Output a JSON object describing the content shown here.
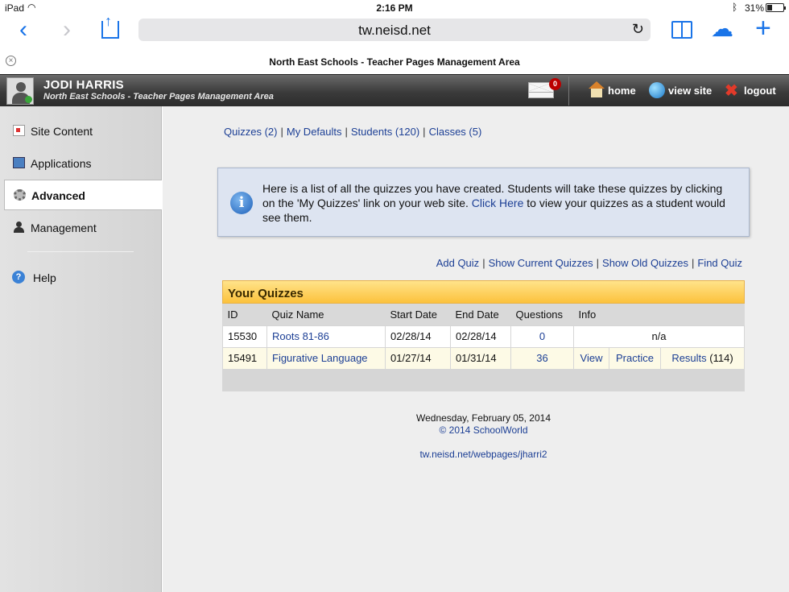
{
  "status_bar": {
    "device": "iPad",
    "time": "2:16 PM",
    "battery": "31%",
    "battery_level": 0.31
  },
  "browser": {
    "url": "tw.neisd.net",
    "tab_title": "North East Schools - Teacher Pages Management Area"
  },
  "header": {
    "user_name": "JODI HARRIS",
    "subtitle": "North East Schools - Teacher Pages Management Area",
    "mail_count": "0",
    "links": {
      "home": "home",
      "view_site": "view site",
      "logout": "logout"
    }
  },
  "sidebar": {
    "items": [
      {
        "label": "Site Content",
        "icon": "site-content-icon"
      },
      {
        "label": "Applications",
        "icon": "applications-icon"
      },
      {
        "label": "Advanced",
        "icon": "gear-icon",
        "active": true
      },
      {
        "label": "Management",
        "icon": "person-icon"
      }
    ],
    "help": "Help"
  },
  "topnav": {
    "quizzes": "Quizzes (2)",
    "my_defaults": "My Defaults",
    "students": "Students (120)",
    "classes": "Classes (5)",
    "separator": "|"
  },
  "info": {
    "text_before": "Here is a list of all the quizzes you have created. Students will take these quizzes by clicking on the 'My Quizzes' link on your web site. ",
    "link": "Click Here",
    "text_after": " to view your quizzes as a student would see them."
  },
  "actions": {
    "add_quiz": "Add Quiz",
    "show_current": "Show Current Quizzes",
    "show_old": "Show Old Quizzes",
    "find_quiz": "Find Quiz"
  },
  "quiz_table": {
    "caption": "Your Quizzes",
    "headers": {
      "id": "ID",
      "name": "Quiz Name",
      "start": "Start Date",
      "end": "End Date",
      "questions": "Questions",
      "info": "Info"
    },
    "rows": [
      {
        "id": "15530",
        "name": "Roots 81-86",
        "start": "02/28/14",
        "end": "02/28/14",
        "questions": "0",
        "info": "n/a"
      },
      {
        "id": "15491",
        "name": "Figurative Language",
        "start": "01/27/14",
        "end": "01/31/14",
        "questions": "36",
        "view": "View",
        "practice": "Practice",
        "results": "Results",
        "results_count": "(114)"
      }
    ]
  },
  "footer": {
    "date": "Wednesday, February 05, 2014",
    "copyright": "© 2014 SchoolWorld",
    "page_url": "tw.neisd.net/webpages/jharri2"
  },
  "colors": {
    "link": "#1c3f95",
    "caption_bg": "#fcc23c",
    "info_bg": "#dde4f1",
    "safari_blue": "#1a74e8"
  }
}
